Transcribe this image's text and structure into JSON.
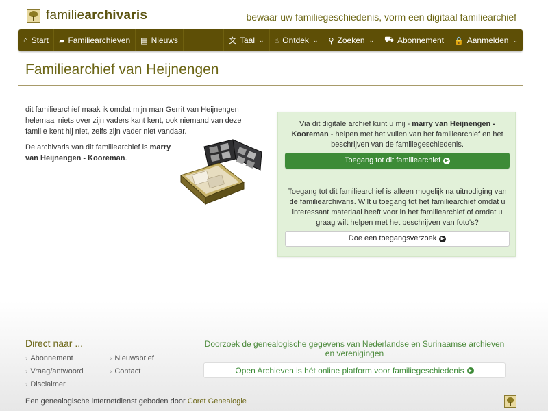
{
  "header": {
    "logo_prefix": "familie",
    "logo_bold": "archivaris",
    "tagline": "bewaar uw familiegeschiedenis, vorm een digitaal familiearchief"
  },
  "nav": {
    "left": [
      {
        "label": "Start",
        "icon": "home-icon",
        "glyph": "⌂"
      },
      {
        "label": "Familiearchieven",
        "icon": "book-icon",
        "glyph": "▰"
      },
      {
        "label": "Nieuws",
        "icon": "newspaper-icon",
        "glyph": "▤"
      }
    ],
    "right": [
      {
        "label": "Taal",
        "icon": "language-icon",
        "glyph": "文"
      },
      {
        "label": "Ontdek",
        "icon": "thumbs-up-icon",
        "glyph": "☝"
      },
      {
        "label": "Zoeken",
        "icon": "search-icon",
        "glyph": "⚲"
      },
      {
        "label": "Abonnement",
        "icon": "cart-icon",
        "glyph": "⛟"
      },
      {
        "label": "Aanmelden",
        "icon": "lock-icon",
        "glyph": "🔒"
      }
    ]
  },
  "page": {
    "title": "Familiearchief van Heijnengen",
    "intro": "dit familiearchief maak ik omdat mijn man Gerrit van Heijnengen helemaal niets over zijn vaders kant kent, ook niemand van deze familie kent hij niet, zelfs zijn vader niet vandaar.",
    "curator_prefix": "De archivaris van dit familiearchief is ",
    "curator_name": "marry van Heijnengen - Kooreman",
    "curator_suffix": "."
  },
  "panel": {
    "text1_prefix": "Via dit digitale archief kunt u mij - ",
    "text1_name": "marry van Heijnengen - Kooreman",
    "text1_suffix": " - helpen met het vullen van het familiearchief en het beschrijven van de familiegeschiedenis.",
    "access_button": "Toegang tot dit familiearchief",
    "text2": "Toegang tot dit familiearchief is alleen mogelijk na uitnodiging van de familiearchivaris. Wilt u toegang tot het familiearchief omdat u interessant materiaal heeft voor in het familiearchief of omdat u graag wilt helpen met het beschrijven van foto's?",
    "request_button": "Doe een toegangsverzoek"
  },
  "footer": {
    "heading": "Direct naar ...",
    "links": [
      "Abonnement",
      "Nieuwsbrief",
      "Vraag/antwoord",
      "Contact",
      "Disclaimer"
    ],
    "oa_text": "Doorzoek de genealogische gegevens van Nederlandse en Surinaamse archieven en verenigingen",
    "oa_button": "Open Archieven is hét online platform voor familiegeschiedenis",
    "bottom_prefix": "Een genealogische internetdienst geboden door ",
    "bottom_link": "Coret Genealogie"
  },
  "colors": {
    "navbar": "#5e4f06",
    "title": "#6c6616",
    "panel_bg": "#e2f1d9",
    "button_green": "#3d8b37"
  }
}
